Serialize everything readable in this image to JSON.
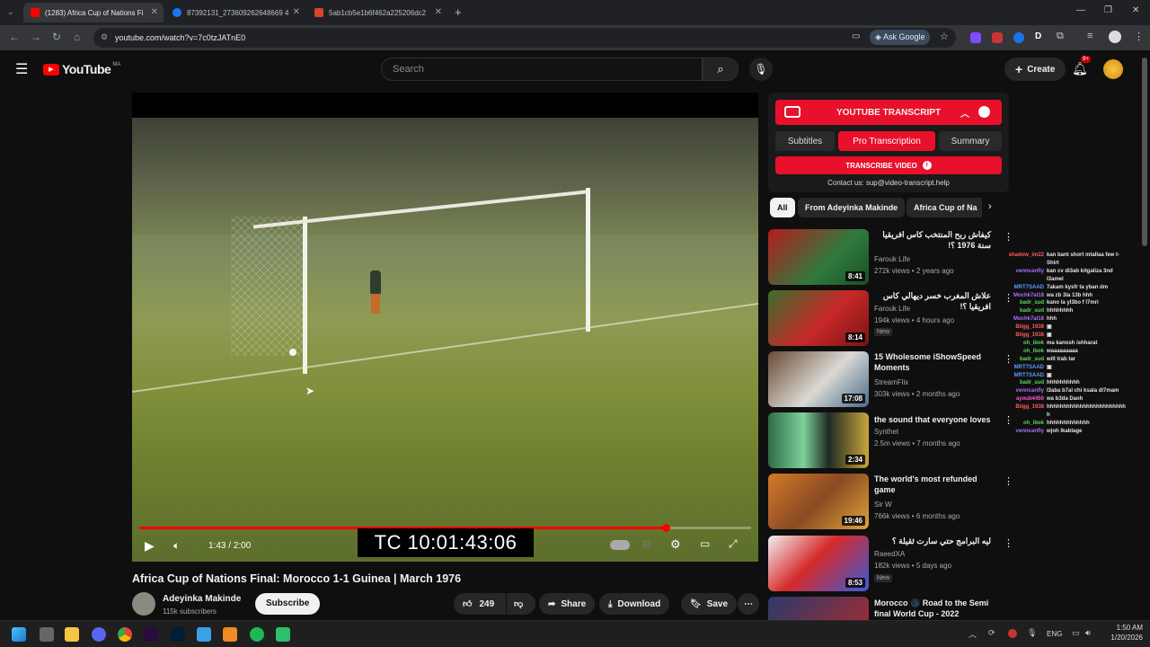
{
  "tabs": [
    {
      "title": "(1283) Africa Cup of Nations Fi",
      "color": "#ff0000"
    },
    {
      "title": "87392131_273609262648669 4",
      "color": "#1877f2"
    },
    {
      "title": "5ab1cb5e1b6f462a225206dc2",
      "color": "#d9442b"
    }
  ],
  "address": {
    "url": "youtube.com/watch?v=7c0tzJATnE0",
    "ask_google": "Ask Google"
  },
  "header": {
    "logo": "YouTube",
    "region": "MA",
    "search_placeholder": "Search",
    "create": "Create",
    "notif_count": "9+"
  },
  "player": {
    "time": "1:43 / 2:00",
    "timecode": "TC 10:01:43:06",
    "progress": 0.86
  },
  "video": {
    "title": "Africa Cup of Nations Final: Morocco 1-1 Guinea | March 1976",
    "channel": "Adeyinka Makinde",
    "subscribers": "115k subscribers",
    "subscribe": "Subscribe",
    "likes": "249",
    "share": "Share",
    "download": "Download",
    "save": "Save"
  },
  "transcript": {
    "header": "YOUTUBE TRANSCRIPT",
    "tab_subtitles": "Subtitles",
    "tab_pro": "Pro Transcription",
    "tab_summary": "Summary",
    "transcribe": "TRANSCRIBE VIDEO",
    "contact": "Contact us: sup@video-transcript.help"
  },
  "chips": [
    "All",
    "From Adeyinka Makinde",
    "Africa Cup of Na"
  ],
  "recs": [
    {
      "title": "كيفاش ربح المنتخب كاس افريقيا سنة 1976 ؟!",
      "channel": "Farouk Life",
      "meta": "272k views • 2 years ago",
      "dur": "8:41",
      "new": ""
    },
    {
      "title": "علاش المغرب خسر ديهالي كاس افريقيا ؟!",
      "channel": "Farouk Life",
      "meta": "194k views • 4 hours ago",
      "dur": "8:14",
      "new": "New"
    },
    {
      "title": "15 Wholesome iShowSpeed Moments",
      "channel": "StreamFlix",
      "meta": "303k views • 2 months ago",
      "dur": "17:08",
      "new": ""
    },
    {
      "title": "the sound that everyone loves",
      "channel": "Synthet",
      "meta": "2.5m views • 7 months ago",
      "dur": "2:34",
      "new": ""
    },
    {
      "title": "The world's most refunded game",
      "channel": "Sir W",
      "meta": "766k views • 6 months ago",
      "dur": "19:46",
      "new": ""
    },
    {
      "title": "ليه البرامج حتي سارت ثقيلة ؟",
      "channel": "RaeedXA",
      "meta": "182k views • 5 days ago",
      "dur": "8:53",
      "new": "New"
    },
    {
      "title": "Morocco 🌑 Road to the Semi final World Cup - 2022",
      "channel": "",
      "meta": "",
      "dur": "",
      "new": ""
    }
  ],
  "chat": [
    {
      "user": "shadow_im22",
      "msg": "kan bant short mtallaa few t-",
      "color": "#ff5b5b"
    },
    {
      "user": "",
      "msg": "Shirt",
      "color": "#ddd"
    },
    {
      "user": "venncanfly",
      "msg": "kan cv di3ab kitgaliza 3nd",
      "color": "#a970ff"
    },
    {
      "user": "",
      "msg": "l3amel",
      "color": "#ddd"
    },
    {
      "user": "MRT7SAAD",
      "msg": "7akam kysfr ta yban dm",
      "color": "#5b9bff"
    },
    {
      "user": "Mochk7al18",
      "msg": "wa zb 3la 13b hhh",
      "color": "#a970ff"
    },
    {
      "user": "badr_sud",
      "msg": "kano la yl3bo f l7mri",
      "color": "#5bd75b"
    },
    {
      "user": "badr_sud",
      "msg": "hhhhhhhh",
      "color": "#5bd75b"
    },
    {
      "user": "Mochk7al18",
      "msg": "hhh",
      "color": "#a970ff"
    },
    {
      "user": "Bilgg_1938",
      "msg": "▣",
      "color": "#ff5b5b"
    },
    {
      "user": "Bilgg_1938",
      "msg": "▣",
      "color": "#ff5b5b"
    },
    {
      "user": "oh_ibok",
      "msg": "ma kanosh ishharat",
      "color": "#5bd75b"
    },
    {
      "user": "oh_ibok",
      "msg": "waaaaaaaaa",
      "color": "#5bd75b"
    },
    {
      "user": "badr_sud",
      "msg": "will trab tar",
      "color": "#5bd75b"
    },
    {
      "user": "MRT7SAAD",
      "msg": "▣",
      "color": "#5b9bff"
    },
    {
      "user": "MRT7SAAD",
      "msg": "▣",
      "color": "#5b9bff"
    },
    {
      "user": "badr_sud",
      "msg": "hhhhhhhhhh",
      "color": "#5bd75b"
    },
    {
      "user": "venncanfly",
      "msg": "l3aba b7al chi ksala dl7mam",
      "color": "#a970ff"
    },
    {
      "user": "ayoub4450",
      "msg": "wa b3da Daoh",
      "color": "#ff5bd7"
    },
    {
      "user": "Bilgg_1938",
      "msg": "hhhhhhhhhhhhhhhhhhhhhhhh",
      "color": "#ff5b5b"
    },
    {
      "user": "",
      "msg": "h",
      "color": "#ddd"
    },
    {
      "user": "oh_ibok",
      "msg": "hhhhhhhhhhhhh",
      "color": "#5bd75b"
    },
    {
      "user": "venncanfly",
      "msg": "wjoh lkablage",
      "color": "#a970ff"
    }
  ],
  "tray": {
    "lang": "ENG",
    "time": "1:50 AM",
    "date": "1/20/2026"
  }
}
